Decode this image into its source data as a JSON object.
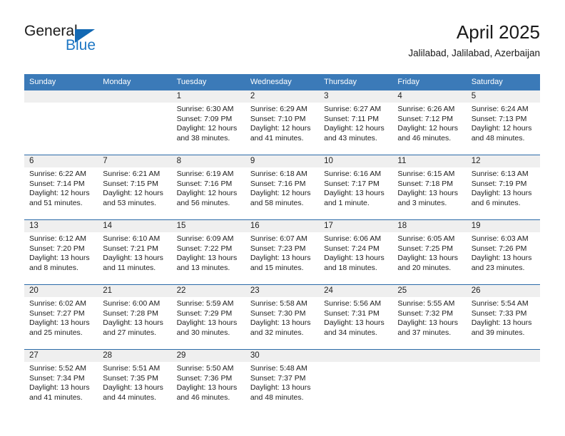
{
  "brand": {
    "name_part1": "General",
    "name_part2": "Blue",
    "accent_color": "#1e77c4",
    "triangle_color": "#1268b3"
  },
  "header": {
    "title": "April 2025",
    "subtitle": "Jalilabad, Jalilabad, Azerbaijan"
  },
  "calendar": {
    "header_bg": "#3b7ab8",
    "row_divider_color": "#2a6aa8",
    "daynum_strip_bg": "#efefef",
    "weekdays": [
      "Sunday",
      "Monday",
      "Tuesday",
      "Wednesday",
      "Thursday",
      "Friday",
      "Saturday"
    ],
    "weeks": [
      [
        {
          "day": "",
          "sunrise": "",
          "sunset": "",
          "daylight_line1": "",
          "daylight_line2": ""
        },
        {
          "day": "",
          "sunrise": "",
          "sunset": "",
          "daylight_line1": "",
          "daylight_line2": ""
        },
        {
          "day": "1",
          "sunrise": "Sunrise: 6:30 AM",
          "sunset": "Sunset: 7:09 PM",
          "daylight_line1": "Daylight: 12 hours",
          "daylight_line2": "and 38 minutes."
        },
        {
          "day": "2",
          "sunrise": "Sunrise: 6:29 AM",
          "sunset": "Sunset: 7:10 PM",
          "daylight_line1": "Daylight: 12 hours",
          "daylight_line2": "and 41 minutes."
        },
        {
          "day": "3",
          "sunrise": "Sunrise: 6:27 AM",
          "sunset": "Sunset: 7:11 PM",
          "daylight_line1": "Daylight: 12 hours",
          "daylight_line2": "and 43 minutes."
        },
        {
          "day": "4",
          "sunrise": "Sunrise: 6:26 AM",
          "sunset": "Sunset: 7:12 PM",
          "daylight_line1": "Daylight: 12 hours",
          "daylight_line2": "and 46 minutes."
        },
        {
          "day": "5",
          "sunrise": "Sunrise: 6:24 AM",
          "sunset": "Sunset: 7:13 PM",
          "daylight_line1": "Daylight: 12 hours",
          "daylight_line2": "and 48 minutes."
        }
      ],
      [
        {
          "day": "6",
          "sunrise": "Sunrise: 6:22 AM",
          "sunset": "Sunset: 7:14 PM",
          "daylight_line1": "Daylight: 12 hours",
          "daylight_line2": "and 51 minutes."
        },
        {
          "day": "7",
          "sunrise": "Sunrise: 6:21 AM",
          "sunset": "Sunset: 7:15 PM",
          "daylight_line1": "Daylight: 12 hours",
          "daylight_line2": "and 53 minutes."
        },
        {
          "day": "8",
          "sunrise": "Sunrise: 6:19 AM",
          "sunset": "Sunset: 7:16 PM",
          "daylight_line1": "Daylight: 12 hours",
          "daylight_line2": "and 56 minutes."
        },
        {
          "day": "9",
          "sunrise": "Sunrise: 6:18 AM",
          "sunset": "Sunset: 7:16 PM",
          "daylight_line1": "Daylight: 12 hours",
          "daylight_line2": "and 58 minutes."
        },
        {
          "day": "10",
          "sunrise": "Sunrise: 6:16 AM",
          "sunset": "Sunset: 7:17 PM",
          "daylight_line1": "Daylight: 13 hours",
          "daylight_line2": "and 1 minute."
        },
        {
          "day": "11",
          "sunrise": "Sunrise: 6:15 AM",
          "sunset": "Sunset: 7:18 PM",
          "daylight_line1": "Daylight: 13 hours",
          "daylight_line2": "and 3 minutes."
        },
        {
          "day": "12",
          "sunrise": "Sunrise: 6:13 AM",
          "sunset": "Sunset: 7:19 PM",
          "daylight_line1": "Daylight: 13 hours",
          "daylight_line2": "and 6 minutes."
        }
      ],
      [
        {
          "day": "13",
          "sunrise": "Sunrise: 6:12 AM",
          "sunset": "Sunset: 7:20 PM",
          "daylight_line1": "Daylight: 13 hours",
          "daylight_line2": "and 8 minutes."
        },
        {
          "day": "14",
          "sunrise": "Sunrise: 6:10 AM",
          "sunset": "Sunset: 7:21 PM",
          "daylight_line1": "Daylight: 13 hours",
          "daylight_line2": "and 11 minutes."
        },
        {
          "day": "15",
          "sunrise": "Sunrise: 6:09 AM",
          "sunset": "Sunset: 7:22 PM",
          "daylight_line1": "Daylight: 13 hours",
          "daylight_line2": "and 13 minutes."
        },
        {
          "day": "16",
          "sunrise": "Sunrise: 6:07 AM",
          "sunset": "Sunset: 7:23 PM",
          "daylight_line1": "Daylight: 13 hours",
          "daylight_line2": "and 15 minutes."
        },
        {
          "day": "17",
          "sunrise": "Sunrise: 6:06 AM",
          "sunset": "Sunset: 7:24 PM",
          "daylight_line1": "Daylight: 13 hours",
          "daylight_line2": "and 18 minutes."
        },
        {
          "day": "18",
          "sunrise": "Sunrise: 6:05 AM",
          "sunset": "Sunset: 7:25 PM",
          "daylight_line1": "Daylight: 13 hours",
          "daylight_line2": "and 20 minutes."
        },
        {
          "day": "19",
          "sunrise": "Sunrise: 6:03 AM",
          "sunset": "Sunset: 7:26 PM",
          "daylight_line1": "Daylight: 13 hours",
          "daylight_line2": "and 23 minutes."
        }
      ],
      [
        {
          "day": "20",
          "sunrise": "Sunrise: 6:02 AM",
          "sunset": "Sunset: 7:27 PM",
          "daylight_line1": "Daylight: 13 hours",
          "daylight_line2": "and 25 minutes."
        },
        {
          "day": "21",
          "sunrise": "Sunrise: 6:00 AM",
          "sunset": "Sunset: 7:28 PM",
          "daylight_line1": "Daylight: 13 hours",
          "daylight_line2": "and 27 minutes."
        },
        {
          "day": "22",
          "sunrise": "Sunrise: 5:59 AM",
          "sunset": "Sunset: 7:29 PM",
          "daylight_line1": "Daylight: 13 hours",
          "daylight_line2": "and 30 minutes."
        },
        {
          "day": "23",
          "sunrise": "Sunrise: 5:58 AM",
          "sunset": "Sunset: 7:30 PM",
          "daylight_line1": "Daylight: 13 hours",
          "daylight_line2": "and 32 minutes."
        },
        {
          "day": "24",
          "sunrise": "Sunrise: 5:56 AM",
          "sunset": "Sunset: 7:31 PM",
          "daylight_line1": "Daylight: 13 hours",
          "daylight_line2": "and 34 minutes."
        },
        {
          "day": "25",
          "sunrise": "Sunrise: 5:55 AM",
          "sunset": "Sunset: 7:32 PM",
          "daylight_line1": "Daylight: 13 hours",
          "daylight_line2": "and 37 minutes."
        },
        {
          "day": "26",
          "sunrise": "Sunrise: 5:54 AM",
          "sunset": "Sunset: 7:33 PM",
          "daylight_line1": "Daylight: 13 hours",
          "daylight_line2": "and 39 minutes."
        }
      ],
      [
        {
          "day": "27",
          "sunrise": "Sunrise: 5:52 AM",
          "sunset": "Sunset: 7:34 PM",
          "daylight_line1": "Daylight: 13 hours",
          "daylight_line2": "and 41 minutes."
        },
        {
          "day": "28",
          "sunrise": "Sunrise: 5:51 AM",
          "sunset": "Sunset: 7:35 PM",
          "daylight_line1": "Daylight: 13 hours",
          "daylight_line2": "and 44 minutes."
        },
        {
          "day": "29",
          "sunrise": "Sunrise: 5:50 AM",
          "sunset": "Sunset: 7:36 PM",
          "daylight_line1": "Daylight: 13 hours",
          "daylight_line2": "and 46 minutes."
        },
        {
          "day": "30",
          "sunrise": "Sunrise: 5:48 AM",
          "sunset": "Sunset: 7:37 PM",
          "daylight_line1": "Daylight: 13 hours",
          "daylight_line2": "and 48 minutes."
        },
        {
          "day": "",
          "sunrise": "",
          "sunset": "",
          "daylight_line1": "",
          "daylight_line2": ""
        },
        {
          "day": "",
          "sunrise": "",
          "sunset": "",
          "daylight_line1": "",
          "daylight_line2": ""
        },
        {
          "day": "",
          "sunrise": "",
          "sunset": "",
          "daylight_line1": "",
          "daylight_line2": ""
        }
      ]
    ]
  }
}
